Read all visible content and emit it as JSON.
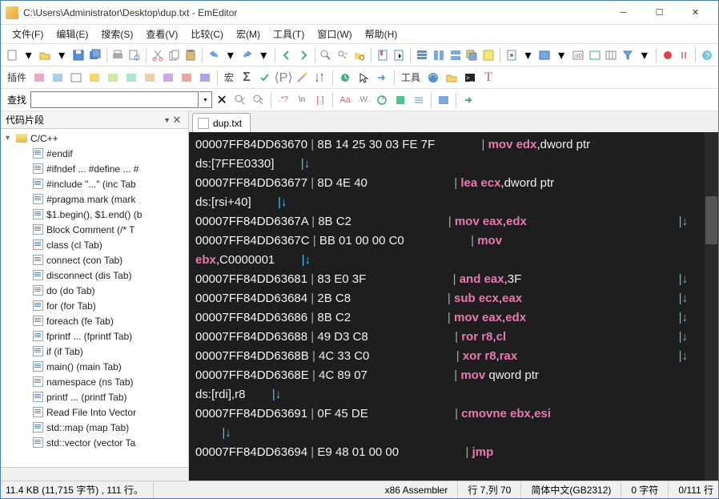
{
  "window": {
    "title": "C:\\Users\\Administrator\\Desktop\\dup.txt - EmEditor"
  },
  "menu": [
    "文件(F)",
    "编辑(E)",
    "搜索(S)",
    "查看(V)",
    "比较(C)",
    "宏(M)",
    "工具(T)",
    "窗口(W)",
    "帮助(H)"
  ],
  "toolbar2": {
    "label_plugins": "插件",
    "label_macro": "宏",
    "label_tools": "工具"
  },
  "find": {
    "label": "查找",
    "placeholder": ""
  },
  "sidepanel": {
    "title": "代码片段",
    "root": "C/C++",
    "items": [
      "#endif",
      "#ifndef ... #define ... #",
      "#include \"...\"  (inc Tab",
      "#pragma mark  (mark",
      "$1.begin(), $1.end()  (b",
      "Block Comment  (/* T",
      "class  (cl Tab)",
      "connect  (con Tab)",
      "disconnect  (dis Tab)",
      "do  (do Tab)",
      "for  (for Tab)",
      "foreach  (fe Tab)",
      "fprintf ...  (fprintf Tab)",
      "if  (if Tab)",
      "main()  (main Tab)",
      "namespace  (ns Tab)",
      "printf ...  (printf Tab)",
      "Read File Into Vector",
      "std::map  (map Tab)",
      "std::vector  (vector Ta"
    ]
  },
  "tab": {
    "name": "dup.txt"
  },
  "code": {
    "lines": [
      {
        "addr": "00007FF84DD63670",
        "hex": "8B 14 25 30 03 FE 7F",
        "inst": "mov",
        "ops": "edx,dword ptr"
      },
      {
        "cont": "ds:[7FFE0330]",
        "arrow": "|↓"
      },
      {
        "addr": "00007FF84DD63677",
        "hex": "8D 4E 40",
        "inst": "lea",
        "ops": "ecx,dword ptr"
      },
      {
        "cont": "ds:[rsi+40]",
        "arrow": "|↓"
      },
      {
        "addr": "00007FF84DD6367A",
        "hex": "8B C2",
        "inst": "mov",
        "ops": "eax,edx",
        "tail": "|↓"
      },
      {
        "addr": "00007FF84DD6367C",
        "hex": "BB 01 00 00 C0",
        "inst": "mov",
        "ops": ""
      },
      {
        "cont": "ebx,C0000001",
        "arrow": "|↓",
        "contreg": true
      },
      {
        "addr": "00007FF84DD63681",
        "hex": "83 E0 3F",
        "inst": "and",
        "ops": "eax,3F",
        "tail": "|↓"
      },
      {
        "addr": "00007FF84DD63684",
        "hex": "2B C8",
        "inst": "sub",
        "ops": "ecx,eax",
        "tail": "|↓"
      },
      {
        "addr": "00007FF84DD63686",
        "hex": "8B C2",
        "inst": "mov",
        "ops": "eax,edx",
        "tail": "|↓"
      },
      {
        "addr": "00007FF84DD63688",
        "hex": "49 D3 C8",
        "inst": "ror",
        "ops": "r8,cl",
        "tail": "|↓"
      },
      {
        "addr": "00007FF84DD6368B",
        "hex": "4C 33 C0",
        "inst": "xor",
        "ops": "r8,rax",
        "tail": "|↓"
      },
      {
        "addr": "00007FF84DD6368E",
        "hex": "4C 89 07",
        "inst": "mov",
        "ops": "qword ptr"
      },
      {
        "cont": "ds:[rdi],r8",
        "arrow": "|↓"
      },
      {
        "addr": "00007FF84DD63691",
        "hex": "0F 45 DE",
        "inst": "cmovne",
        "ops": "ebx,esi"
      },
      {
        "cont": "",
        "arrow": "|↓"
      },
      {
        "addr": "00007FF84DD63694",
        "hex": "E9 48 01 00 00",
        "inst": "jmp",
        "ops": ""
      }
    ]
  },
  "status": {
    "size": "11.4 KB (11,715 字节) , 111 行。",
    "lang": "x86 Assembler",
    "pos": "行 7,列 70",
    "enc": "简体中文(GB2312)",
    "sel": "0 字符",
    "lines": "0/111 行"
  }
}
